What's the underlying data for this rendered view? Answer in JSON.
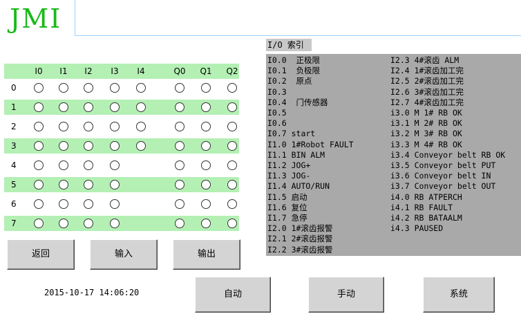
{
  "logo": "JMI",
  "io_index": {
    "title": "I/O  索引",
    "left": [
      "I0.0  正极限",
      "I0.1  负极限",
      "I0.2  原点",
      "I0.3",
      "I0.4  门传感器",
      "I0.5",
      "I0.6",
      "I0.7 start",
      "I1.0 1#Robot FAULT",
      "I1.1 BIN ALM",
      "I1.2 JOG+",
      "I1.3 JOG-",
      "I1.4 AUTO/RUN",
      "I1.5 启动",
      "I1.6 复位",
      "I1.7 急停",
      "I2.0 1#滚齿报警",
      "I2.1 2#滚齿报警",
      "I2.2 3#滚齿报警"
    ],
    "right": [
      "I2.3 4#滚齿 ALM",
      "I2.4 1#滚齿加工完",
      "I2.5 2#滚齿加工完",
      "I2.6 3#滚齿加工完",
      "I2.7 4#滚齿加工完",
      "i3.0 M 1# RB OK",
      "i3.1 M 2# RB OK",
      "i3.2 M 3# RB OK",
      "i3.3 M 4# RB OK",
      "i3.4 Conveyor belt RB OK",
      "i3.5 Conveyor belt PUT",
      "i3.6 Conveyor belt IN",
      "i3.7 Conveyor belt OUT",
      "i4.0 RB ATPERCH",
      "i4.1 RB FAULT",
      "i4.2 RB BATAALM",
      "i4.3 PAUSED"
    ]
  },
  "grid": {
    "col_headers": [
      "I0",
      "I1",
      "I2",
      "I3",
      "I4",
      "Q0",
      "Q1",
      "Q2"
    ],
    "rows": [
      {
        "label": "0",
        "leds": [
          1,
          1,
          1,
          1,
          1,
          1,
          1,
          1
        ]
      },
      {
        "label": "1",
        "leds": [
          1,
          1,
          1,
          1,
          1,
          1,
          1,
          1
        ]
      },
      {
        "label": "2",
        "leds": [
          1,
          1,
          1,
          1,
          1,
          1,
          1,
          1
        ]
      },
      {
        "label": "3",
        "leds": [
          1,
          1,
          1,
          1,
          1,
          1,
          1,
          1
        ]
      },
      {
        "label": "4",
        "leds": [
          1,
          1,
          1,
          1,
          0,
          1,
          1,
          1
        ]
      },
      {
        "label": "5",
        "leds": [
          1,
          1,
          1,
          1,
          0,
          1,
          1,
          1
        ]
      },
      {
        "label": "6",
        "leds": [
          1,
          1,
          1,
          1,
          0,
          1,
          1,
          1
        ]
      },
      {
        "label": "7",
        "leds": [
          1,
          1,
          1,
          1,
          0,
          1,
          1,
          1
        ]
      }
    ]
  },
  "nav": {
    "back": "返回",
    "input": "输入",
    "output": "输出"
  },
  "bottom": {
    "datetime": "2015-10-17 14:06:20",
    "auto": "自动",
    "manual": "手动",
    "system": "系统"
  }
}
